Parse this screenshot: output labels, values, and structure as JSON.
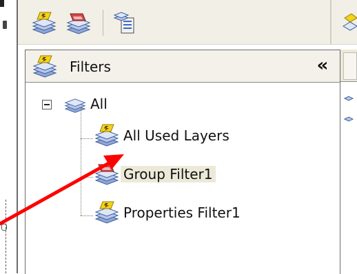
{
  "toolbar": {
    "buttons": [
      {
        "name": "new-property-filter-icon"
      },
      {
        "name": "new-group-filter-icon"
      },
      {
        "name": "layer-states-manager-icon"
      }
    ]
  },
  "panel": {
    "title": "Filters",
    "collapse_label": "«"
  },
  "tree": {
    "root": {
      "label": "All",
      "expanded": true
    },
    "children": [
      {
        "label": "All Used Layers",
        "icon": "used-layers-filter-icon"
      },
      {
        "label": "Group Filter1",
        "icon": "group-filter-icon",
        "selected": true
      },
      {
        "label": "Properties Filter1",
        "icon": "property-filter-icon"
      }
    ]
  },
  "colors": {
    "accent_yellow": "#f2d21b",
    "layer_blue": "#5a7fc7",
    "group_red": "#d1494a",
    "arrow_red": "#ff0000",
    "selected_bg": "#ece9d8"
  }
}
